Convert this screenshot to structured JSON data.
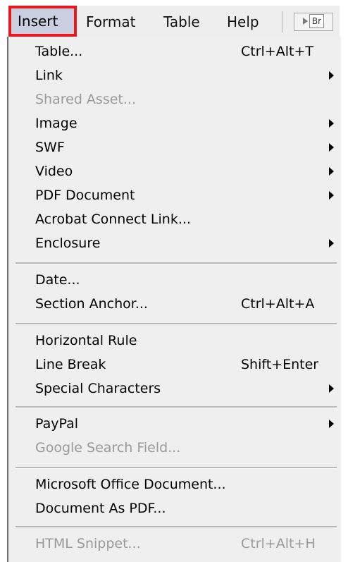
{
  "menubar": {
    "insert_label": "Insert",
    "format_label": "Format",
    "table_label": "Table",
    "help_label": "Help",
    "bridge_label": "Br"
  },
  "menu": {
    "items": [
      {
        "label": "Table...",
        "shortcut": "Ctrl+Alt+T",
        "submenu": false,
        "enabled": true
      },
      {
        "label": "Link",
        "shortcut": "",
        "submenu": true,
        "enabled": true
      },
      {
        "label": "Shared Asset...",
        "shortcut": "",
        "submenu": false,
        "enabled": false
      },
      {
        "label": "Image",
        "shortcut": "",
        "submenu": true,
        "enabled": true
      },
      {
        "label": "SWF",
        "shortcut": "",
        "submenu": true,
        "enabled": true
      },
      {
        "label": "Video",
        "shortcut": "",
        "submenu": true,
        "enabled": true
      },
      {
        "label": "PDF Document",
        "shortcut": "",
        "submenu": true,
        "enabled": true
      },
      {
        "label": "Acrobat Connect Link...",
        "shortcut": "",
        "submenu": false,
        "enabled": true
      },
      {
        "label": "Enclosure",
        "shortcut": "",
        "submenu": true,
        "enabled": true
      },
      {
        "label": "Date...",
        "shortcut": "",
        "submenu": false,
        "enabled": true
      },
      {
        "label": "Section Anchor...",
        "shortcut": "Ctrl+Alt+A",
        "submenu": false,
        "enabled": true
      },
      {
        "label": "Horizontal Rule",
        "shortcut": "",
        "submenu": false,
        "enabled": true
      },
      {
        "label": "Line Break",
        "shortcut": "Shift+Enter",
        "submenu": false,
        "enabled": true
      },
      {
        "label": "Special Characters",
        "shortcut": "",
        "submenu": true,
        "enabled": true
      },
      {
        "label": "PayPal",
        "shortcut": "",
        "submenu": true,
        "enabled": true
      },
      {
        "label": "Google Search Field...",
        "shortcut": "",
        "submenu": false,
        "enabled": false
      },
      {
        "label": "Microsoft Office Document...",
        "shortcut": "",
        "submenu": false,
        "enabled": true
      },
      {
        "label": "Document As PDF...",
        "shortcut": "",
        "submenu": false,
        "enabled": true
      },
      {
        "label": "HTML Snippet...",
        "shortcut": "Ctrl+Alt+H",
        "submenu": false,
        "enabled": false
      }
    ]
  },
  "colors": {
    "highlight_border": "#e8181f",
    "menu_background": "#efefef",
    "disabled_text": "#9a9a9a"
  }
}
